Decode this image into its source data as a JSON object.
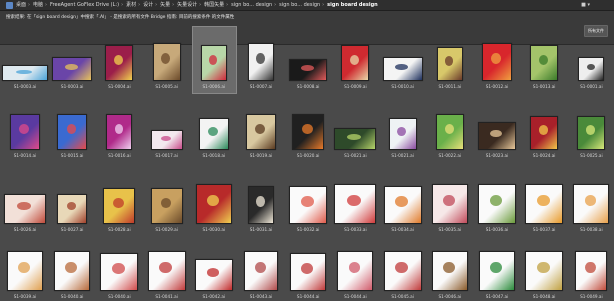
{
  "topbar": {
    "crumbs": [
      "桌面",
      "电脑",
      "FreeAgent GoFlex Drive (L:)",
      "素材",
      "设计",
      "矢量",
      "矢量设计",
      "韩国矢量",
      "sign bo... design",
      "sign bo... design",
      "sign board design"
    ],
    "right_label": "■ ▾"
  },
  "filterbar": {
    "path": "搜索结果: 在「sign board design」中搜索「.AI」 - 是搜索的所有文件 Bridge 指南: 目前的搜索条件 的文件属性",
    "right_button": "所有文件"
  },
  "thumbnails": [
    {
      "label": "S1-0003.ai",
      "color": "#dfeaf0",
      "accent": "#4aa3d8",
      "w": 44,
      "h": 14
    },
    {
      "label": "S1-0003.ai",
      "color": "#6a45a8",
      "accent": "#e8c35a",
      "w": 38,
      "h": 22
    },
    {
      "label": "S1-0004.ai",
      "color": "#9b1e4a",
      "accent": "#f2d24e",
      "w": 26,
      "h": 34
    },
    {
      "label": "S1-0005.ai",
      "color": "#c7a97a",
      "accent": "#6b4a2a",
      "w": 26,
      "h": 36
    },
    {
      "label": "S1-0006.ai",
      "color": "#b8d7a8",
      "accent": "#d0283b",
      "w": 24,
      "h": 34,
      "selected": true
    },
    {
      "label": "S1-0007.ai",
      "color": "#f1f1f1",
      "accent": "#333",
      "w": 24,
      "h": 36
    },
    {
      "label": "S1-0008.ai",
      "color": "#1a1a1a",
      "accent": "#e35b5b",
      "w": 36,
      "h": 20
    },
    {
      "label": "S1-0009.ai",
      "color": "#cf2a30",
      "accent": "#e8d8a8",
      "w": 26,
      "h": 34
    },
    {
      "label": "S1-0010.ai",
      "color": "#f4f4f4",
      "accent": "#1d2f5c",
      "w": 38,
      "h": 22
    },
    {
      "label": "S1-0011.ai",
      "color": "#d8c86a",
      "accent": "#6a3a2a",
      "w": 24,
      "h": 32
    },
    {
      "label": "S1-0012.ai",
      "color": "#d8262c",
      "accent": "#f0a040",
      "w": 28,
      "h": 36
    },
    {
      "label": "S1-0013.ai",
      "color": "#a4c46a",
      "accent": "#3a7a2a",
      "w": 26,
      "h": 34
    },
    {
      "label": "S1-0001.ai",
      "color": "#eee",
      "accent": "#222",
      "w": 24,
      "h": 22
    },
    {
      "label": "S1-0014.ai",
      "color": "#5a3aa0",
      "accent": "#e04a8a",
      "w": 28,
      "h": 34
    },
    {
      "label": "S1-0015.ai",
      "color": "#3a6ad0",
      "accent": "#e84a4a",
      "w": 28,
      "h": 34
    },
    {
      "label": "S1-0016.ai",
      "color": "#b02a8a",
      "accent": "#f0d0f0",
      "w": 24,
      "h": 34
    },
    {
      "label": "S1-0017.ai",
      "color": "#f2e8ee",
      "accent": "#c84a8a",
      "w": 30,
      "h": 18
    },
    {
      "label": "S1-0018.ai",
      "color": "#f3f3f3",
      "accent": "#2a8a5a",
      "w": 28,
      "h": 30
    },
    {
      "label": "S1-0019.ai",
      "color": "#d8c8a0",
      "accent": "#5a3a20",
      "w": 28,
      "h": 34
    },
    {
      "label": "S1-0020.ai",
      "color": "#202020",
      "accent": "#e87a2a",
      "w": 30,
      "h": 34
    },
    {
      "label": "S1-0021.ai",
      "color": "#2e4a2a",
      "accent": "#b6d46a",
      "w": 40,
      "h": 20
    },
    {
      "label": "S1-0021.ai",
      "color": "#eef2f4",
      "accent": "#8a4aa0",
      "w": 26,
      "h": 30
    },
    {
      "label": "S1-0022.ai",
      "color": "#6ab04a",
      "accent": "#e8e07a",
      "w": 26,
      "h": 34
    },
    {
      "label": "S1-0023.ai",
      "color": "#3a2a20",
      "accent": "#e8c89a",
      "w": 36,
      "h": 26
    },
    {
      "label": "S1-0024.ai",
      "color": "#a8202a",
      "accent": "#f2c84a",
      "w": 26,
      "h": 32
    },
    {
      "label": "S1-0025.ai",
      "color": "#4a8a3a",
      "accent": "#d8e87a",
      "w": 26,
      "h": 32
    },
    {
      "label": "S1-0026.ai",
      "color": "#f2e0d8",
      "accent": "#c04a3a",
      "w": 40,
      "h": 28
    },
    {
      "label": "S1-0027.ai",
      "color": "#e8d8b8",
      "accent": "#a0402a",
      "w": 28,
      "h": 28
    },
    {
      "label": "S1-0028.ai",
      "color": "#e8c24a",
      "accent": "#c03a2a",
      "w": 30,
      "h": 34
    },
    {
      "label": "S1-0029.ai",
      "color": "#c8a060",
      "accent": "#6a4a2a",
      "w": 30,
      "h": 34
    },
    {
      "label": "S1-0030.ai",
      "color": "#b82a2a",
      "accent": "#f0d050",
      "w": 34,
      "h": 38
    },
    {
      "label": "S1-0031.ai",
      "color": "#2a2a2a",
      "accent": "#f0e8d8",
      "w": 24,
      "h": 36
    },
    {
      "label": "S1-0032.ai",
      "color": "#fafafa",
      "accent": "#e05a4a",
      "w": 36,
      "h": 36
    },
    {
      "label": "S1-0033.ai",
      "color": "#fafafa",
      "accent": "#d03a3a",
      "w": 40,
      "h": 38
    },
    {
      "label": "S1-0034.ai",
      "color": "#fafafa",
      "accent": "#e07a2a",
      "w": 36,
      "h": 36
    },
    {
      "label": "S1-0035.ai",
      "color": "#f6e8e8",
      "accent": "#c04a5a",
      "w": 34,
      "h": 38
    },
    {
      "label": "S1-0036.ai",
      "color": "#fafafa",
      "accent": "#6a9a3a",
      "w": 36,
      "h": 38
    },
    {
      "label": "S1-0037.ai",
      "color": "#fafafa",
      "accent": "#e89a2a",
      "w": 36,
      "h": 38
    },
    {
      "label": "S1-0038.ai",
      "color": "#fafafa",
      "accent": "#e8a04a",
      "w": 34,
      "h": 38
    },
    {
      "label": "S1-0039.ai",
      "color": "#fafafa",
      "accent": "#e0a050",
      "w": 34,
      "h": 38
    },
    {
      "label": "S1-0040.ai",
      "color": "#fafafa",
      "accent": "#b86a3a",
      "w": 34,
      "h": 38
    },
    {
      "label": "S1-0040.ai",
      "color": "#fafafa",
      "accent": "#d04a4a",
      "w": 36,
      "h": 36
    },
    {
      "label": "S1-0041.ai",
      "color": "#fafafa",
      "accent": "#c03a3a",
      "w": 36,
      "h": 38
    },
    {
      "label": "S1-0042.ai",
      "color": "#fafafa",
      "accent": "#c02a2a",
      "w": 36,
      "h": 30
    },
    {
      "label": "S1-0043.ai",
      "color": "#fafafa",
      "accent": "#b04a4a",
      "w": 32,
      "h": 38
    },
    {
      "label": "S1-0044.ai",
      "color": "#fafafa",
      "accent": "#c03a3a",
      "w": 34,
      "h": 36
    },
    {
      "label": "S1-0044.ai",
      "color": "#fafafa",
      "accent": "#d05a6a",
      "w": 34,
      "h": 38
    },
    {
      "label": "S1-0045.ai",
      "color": "#fafafa",
      "accent": "#c03a3a",
      "w": 36,
      "h": 38
    },
    {
      "label": "S1-0046.ai",
      "color": "#fafafa",
      "accent": "#8a5a2a",
      "w": 34,
      "h": 38
    },
    {
      "label": "S1-0047.ai",
      "color": "#fafafa",
      "accent": "#2a8a3a",
      "w": 34,
      "h": 38
    },
    {
      "label": "S1-0048.ai",
      "color": "#fafafa",
      "accent": "#c0a040",
      "w": 36,
      "h": 38
    },
    {
      "label": "S1-0049.ai",
      "color": "#fafafa",
      "accent": "#c04a3a",
      "w": 30,
      "h": 38
    }
  ]
}
